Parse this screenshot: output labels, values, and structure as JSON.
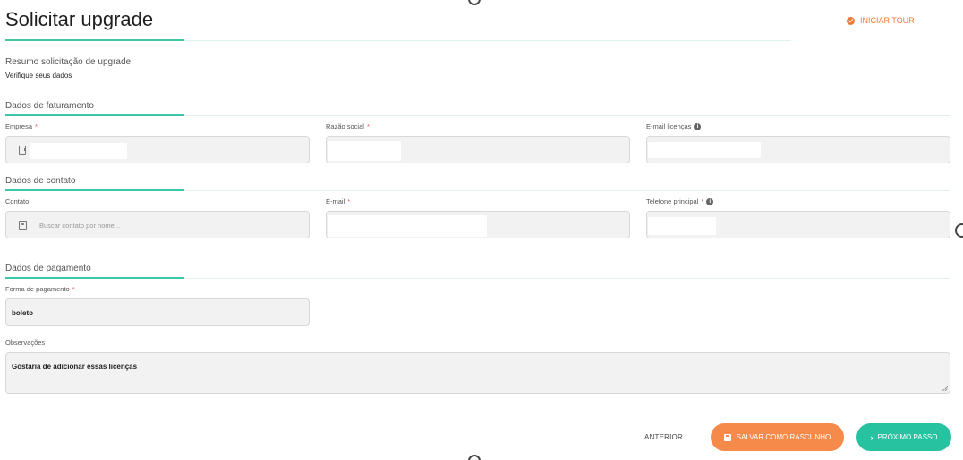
{
  "header": {
    "title": "Solicitar upgrade",
    "tour_label": "INICIAR TOUR"
  },
  "summary": {
    "title": "Resumo solicitação de upgrade",
    "subtitle": "Verifique seus dados"
  },
  "billing": {
    "section_title": "Dados de faturamento",
    "company_label": "Empresa",
    "company_name_label": "Razão social",
    "license_email_label": "E-mail licenças"
  },
  "contact": {
    "section_title": "Dados de contato",
    "contact_label": "Contato",
    "contact_placeholder": "Buscar contato por nome...",
    "email_label": "E-mail",
    "phone_label": "Telefone principal"
  },
  "payment": {
    "section_title": "Dados de pagamento",
    "method_label": "Forma de pagamento",
    "method_value": "boleto",
    "notes_label": "Observações",
    "notes_value": "Gostaria de adicionar essas licenças"
  },
  "footer": {
    "prev_label": "ANTERIOR",
    "draft_label": "SALVAR COMO RASCUNHO",
    "next_label": "PRÓXIMO PASSO"
  },
  "required_mark": "*",
  "info_mark": "i",
  "icons": {
    "tour": "check-circle-icon",
    "company": "building-icon",
    "contact": "contact-card-icon",
    "info": "info-icon",
    "save": "save-icon",
    "next": "chevron-right-icon"
  },
  "colors": {
    "accent_teal": "#3cc8a8",
    "accent_orange": "#f58a4a",
    "next_button": "#27c2a0",
    "required": "#e05555"
  }
}
